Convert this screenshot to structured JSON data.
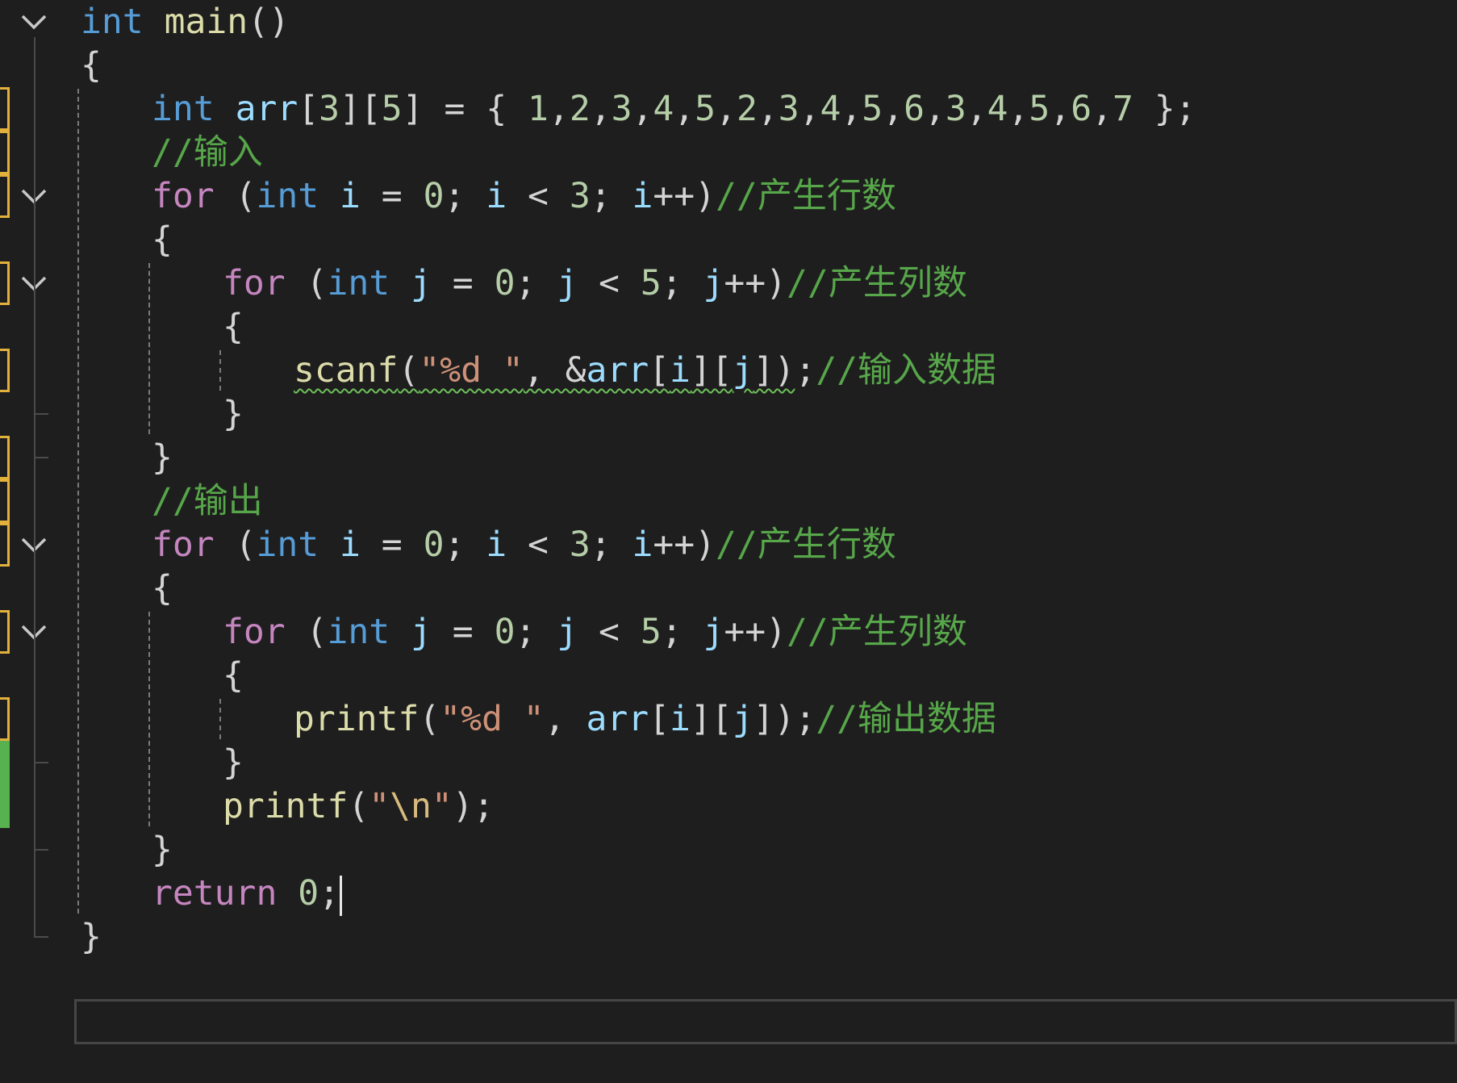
{
  "editor": {
    "lines": [
      [
        {
          "t": "int",
          "c": "kw"
        },
        {
          "t": " ",
          "c": "punc"
        },
        {
          "t": "main",
          "c": "fn"
        },
        {
          "t": "()",
          "c": "punc"
        }
      ],
      [
        {
          "t": "{",
          "c": "punc"
        }
      ],
      [
        {
          "t": "int",
          "c": "kw"
        },
        {
          "t": " ",
          "c": "punc"
        },
        {
          "t": "arr",
          "c": "var"
        },
        {
          "t": "[",
          "c": "punc"
        },
        {
          "t": "3",
          "c": "num"
        },
        {
          "t": "][",
          "c": "punc"
        },
        {
          "t": "5",
          "c": "num"
        },
        {
          "t": "] = { ",
          "c": "punc"
        },
        {
          "t": "1",
          "c": "num"
        },
        {
          "t": ",",
          "c": "punc"
        },
        {
          "t": "2",
          "c": "num"
        },
        {
          "t": ",",
          "c": "punc"
        },
        {
          "t": "3",
          "c": "num"
        },
        {
          "t": ",",
          "c": "punc"
        },
        {
          "t": "4",
          "c": "num"
        },
        {
          "t": ",",
          "c": "punc"
        },
        {
          "t": "5",
          "c": "num"
        },
        {
          "t": ",",
          "c": "punc"
        },
        {
          "t": "2",
          "c": "num"
        },
        {
          "t": ",",
          "c": "punc"
        },
        {
          "t": "3",
          "c": "num"
        },
        {
          "t": ",",
          "c": "punc"
        },
        {
          "t": "4",
          "c": "num"
        },
        {
          "t": ",",
          "c": "punc"
        },
        {
          "t": "5",
          "c": "num"
        },
        {
          "t": ",",
          "c": "punc"
        },
        {
          "t": "6",
          "c": "num"
        },
        {
          "t": ",",
          "c": "punc"
        },
        {
          "t": "3",
          "c": "num"
        },
        {
          "t": ",",
          "c": "punc"
        },
        {
          "t": "4",
          "c": "num"
        },
        {
          "t": ",",
          "c": "punc"
        },
        {
          "t": "5",
          "c": "num"
        },
        {
          "t": ",",
          "c": "punc"
        },
        {
          "t": "6",
          "c": "num"
        },
        {
          "t": ",",
          "c": "punc"
        },
        {
          "t": "7",
          "c": "num"
        },
        {
          "t": " };",
          "c": "punc"
        }
      ],
      [
        {
          "t": "//输入",
          "c": "cmt"
        }
      ],
      [
        {
          "t": "for",
          "c": "ctl"
        },
        {
          "t": " (",
          "c": "punc"
        },
        {
          "t": "int",
          "c": "kw"
        },
        {
          "t": " ",
          "c": "punc"
        },
        {
          "t": "i",
          "c": "var"
        },
        {
          "t": " = ",
          "c": "punc"
        },
        {
          "t": "0",
          "c": "num"
        },
        {
          "t": "; ",
          "c": "punc"
        },
        {
          "t": "i",
          "c": "var"
        },
        {
          "t": " < ",
          "c": "punc"
        },
        {
          "t": "3",
          "c": "num"
        },
        {
          "t": "; ",
          "c": "punc"
        },
        {
          "t": "i",
          "c": "var"
        },
        {
          "t": "++)",
          "c": "punc"
        },
        {
          "t": "//产生行数",
          "c": "cmt"
        }
      ],
      [
        {
          "t": "{",
          "c": "punc"
        }
      ],
      [
        {
          "t": "for",
          "c": "ctl"
        },
        {
          "t": " (",
          "c": "punc"
        },
        {
          "t": "int",
          "c": "kw"
        },
        {
          "t": " ",
          "c": "punc"
        },
        {
          "t": "j",
          "c": "var"
        },
        {
          "t": " = ",
          "c": "punc"
        },
        {
          "t": "0",
          "c": "num"
        },
        {
          "t": "; ",
          "c": "punc"
        },
        {
          "t": "j",
          "c": "var"
        },
        {
          "t": " < ",
          "c": "punc"
        },
        {
          "t": "5",
          "c": "num"
        },
        {
          "t": "; ",
          "c": "punc"
        },
        {
          "t": "j",
          "c": "var"
        },
        {
          "t": "++)",
          "c": "punc"
        },
        {
          "t": "//产生列数",
          "c": "cmt"
        }
      ],
      [
        {
          "t": "{",
          "c": "punc"
        }
      ],
      [
        {
          "t": "scanf",
          "c": "fn",
          "sq": true
        },
        {
          "t": "(",
          "c": "punc",
          "sq": true
        },
        {
          "t": "\"%d \"",
          "c": "str",
          "sq": true
        },
        {
          "t": ", &",
          "c": "punc",
          "sq": true
        },
        {
          "t": "arr",
          "c": "var",
          "sq": true
        },
        {
          "t": "[",
          "c": "punc",
          "sq": true
        },
        {
          "t": "i",
          "c": "var",
          "sq": true
        },
        {
          "t": "][",
          "c": "punc",
          "sq": true
        },
        {
          "t": "j",
          "c": "var",
          "sq": true
        },
        {
          "t": "])",
          "c": "punc",
          "sq": true
        },
        {
          "t": ";",
          "c": "punc"
        },
        {
          "t": "//输入数据",
          "c": "cmt"
        }
      ],
      [
        {
          "t": "}",
          "c": "punc"
        }
      ],
      [
        {
          "t": "}",
          "c": "punc"
        }
      ],
      [
        {
          "t": "//输出",
          "c": "cmt"
        }
      ],
      [
        {
          "t": "for",
          "c": "ctl"
        },
        {
          "t": " (",
          "c": "punc"
        },
        {
          "t": "int",
          "c": "kw"
        },
        {
          "t": " ",
          "c": "punc"
        },
        {
          "t": "i",
          "c": "var"
        },
        {
          "t": " = ",
          "c": "punc"
        },
        {
          "t": "0",
          "c": "num"
        },
        {
          "t": "; ",
          "c": "punc"
        },
        {
          "t": "i",
          "c": "var"
        },
        {
          "t": " < ",
          "c": "punc"
        },
        {
          "t": "3",
          "c": "num"
        },
        {
          "t": "; ",
          "c": "punc"
        },
        {
          "t": "i",
          "c": "var"
        },
        {
          "t": "++)",
          "c": "punc"
        },
        {
          "t": "//产生行数",
          "c": "cmt"
        }
      ],
      [
        {
          "t": "{",
          "c": "punc"
        }
      ],
      [
        {
          "t": "for",
          "c": "ctl"
        },
        {
          "t": " (",
          "c": "punc"
        },
        {
          "t": "int",
          "c": "kw"
        },
        {
          "t": " ",
          "c": "punc"
        },
        {
          "t": "j",
          "c": "var"
        },
        {
          "t": " = ",
          "c": "punc"
        },
        {
          "t": "0",
          "c": "num"
        },
        {
          "t": "; ",
          "c": "punc"
        },
        {
          "t": "j",
          "c": "var"
        },
        {
          "t": " < ",
          "c": "punc"
        },
        {
          "t": "5",
          "c": "num"
        },
        {
          "t": "; ",
          "c": "punc"
        },
        {
          "t": "j",
          "c": "var"
        },
        {
          "t": "++)",
          "c": "punc"
        },
        {
          "t": "//产生列数",
          "c": "cmt"
        }
      ],
      [
        {
          "t": "{",
          "c": "punc"
        }
      ],
      [
        {
          "t": "printf",
          "c": "fn"
        },
        {
          "t": "(",
          "c": "punc"
        },
        {
          "t": "\"%d \"",
          "c": "str"
        },
        {
          "t": ", ",
          "c": "punc"
        },
        {
          "t": "arr",
          "c": "var"
        },
        {
          "t": "[",
          "c": "punc"
        },
        {
          "t": "i",
          "c": "var"
        },
        {
          "t": "][",
          "c": "punc"
        },
        {
          "t": "j",
          "c": "var"
        },
        {
          "t": "]);",
          "c": "punc"
        },
        {
          "t": "//输出数据",
          "c": "cmt"
        }
      ],
      [
        {
          "t": "}",
          "c": "punc"
        }
      ],
      [
        {
          "t": "printf",
          "c": "fn"
        },
        {
          "t": "(",
          "c": "punc"
        },
        {
          "t": "\"",
          "c": "str"
        },
        {
          "t": "\\n",
          "c": "esc"
        },
        {
          "t": "\"",
          "c": "str"
        },
        {
          "t": ");",
          "c": "punc"
        }
      ],
      [
        {
          "t": "}",
          "c": "punc"
        }
      ],
      [
        {
          "t": "return",
          "c": "ctl"
        },
        {
          "t": " ",
          "c": "punc"
        },
        {
          "t": "0",
          "c": "num"
        },
        {
          "t": ";",
          "c": "punc"
        }
      ],
      [
        {
          "t": "}",
          "c": "punc"
        }
      ]
    ],
    "indent_levels": [
      0,
      0,
      1,
      1,
      1,
      1,
      2,
      2,
      3,
      2,
      1,
      1,
      1,
      1,
      2,
      2,
      3,
      2,
      2,
      1,
      1,
      0
    ],
    "line_status": [
      "none",
      "none",
      "modified",
      "modified",
      "modified",
      "none",
      "modified",
      "none",
      "modified",
      "none",
      "modified",
      "modified",
      "modified",
      "none",
      "modified",
      "none",
      "modified",
      "saved",
      "saved",
      "none",
      "none",
      "none"
    ],
    "foldable_lines": [
      0,
      4,
      6,
      12,
      14
    ],
    "current_line": 20,
    "caret_after_line_text": true,
    "colors": {
      "background": "#1e1e1e",
      "keyword": "#569cd6",
      "control": "#c586c0",
      "function": "#dcdcaa",
      "variable": "#9cdcfe",
      "number": "#b5cea8",
      "string": "#ce9178",
      "escape": "#d7ba7d",
      "comment": "#57a64a",
      "modified_marker": "#e2b13c",
      "saved_marker": "#56b14e",
      "squiggle": "#6ec05a"
    },
    "icons": {
      "fold": "chevron-down-icon"
    }
  }
}
